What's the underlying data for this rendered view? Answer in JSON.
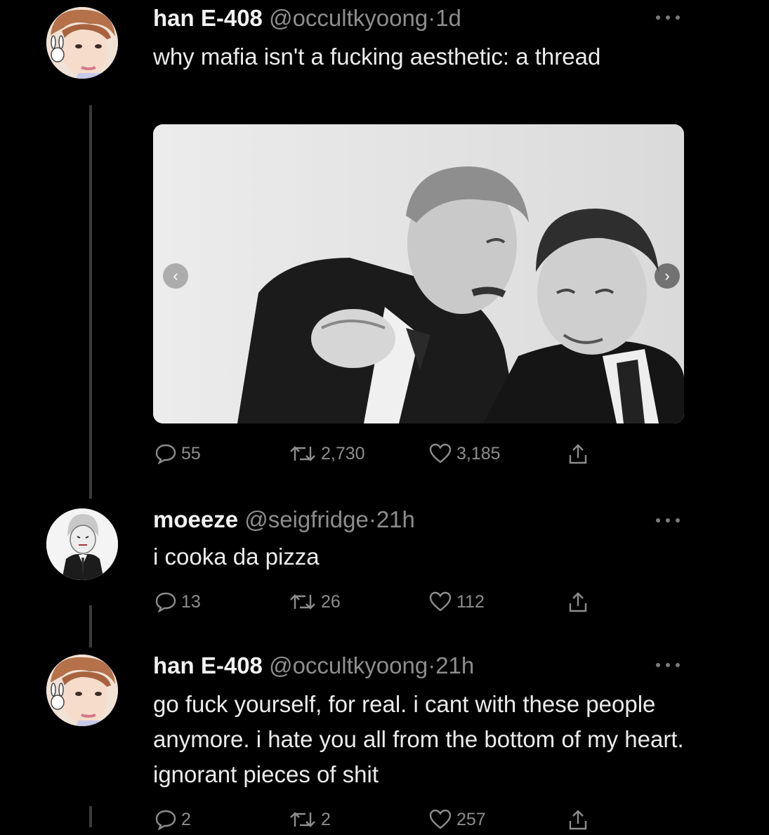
{
  "tweets": [
    {
      "name": "han E-408",
      "handle": "@occultkyoong",
      "separator": "·",
      "time": "1d",
      "text": "why mafia isn't a fucking aesthetic: a thread",
      "replies": "55",
      "retweets": "2,730",
      "likes": "3,185",
      "avatar_icon": "profile-photo-icon"
    },
    {
      "name": "moeeze",
      "handle": "@seigfridge",
      "separator": "·",
      "time": "21h",
      "text": "i cooka da pizza",
      "replies": "13",
      "retweets": "26",
      "likes": "112",
      "avatar_icon": "anime-character-icon"
    },
    {
      "name": "han E-408",
      "handle": "@occultkyoong",
      "separator": "·",
      "time": "21h",
      "text": "go fuck yourself, for real. i cant with these people anymore. i hate you all from the bottom of my heart. ignorant pieces of shit",
      "replies": "2",
      "retweets": "2",
      "likes": "257",
      "avatar_icon": "profile-photo-icon"
    }
  ],
  "media": {
    "type": "black-and-white-photo",
    "prev_icon": "chevron-left-icon",
    "next_icon": "chevron-right-icon"
  },
  "colors": {
    "background": "#000000",
    "text": "#ececec",
    "muted": "#8d8d8d",
    "thread_line": "#3a3a3a"
  }
}
